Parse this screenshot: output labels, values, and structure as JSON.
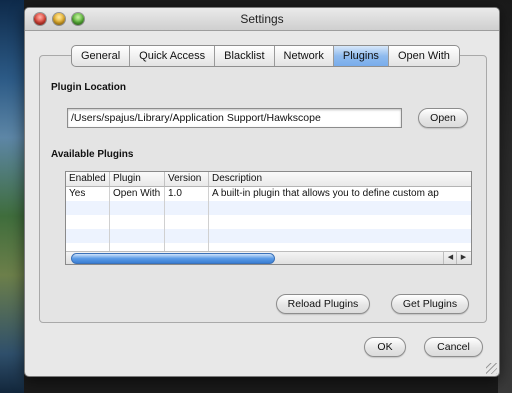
{
  "window": {
    "title": "Settings"
  },
  "tabs": [
    {
      "label": "General"
    },
    {
      "label": "Quick Access"
    },
    {
      "label": "Blacklist"
    },
    {
      "label": "Network"
    },
    {
      "label": "Plugins"
    },
    {
      "label": "Open With"
    }
  ],
  "plugin_location": {
    "label": "Plugin Location",
    "value": "/Users/spajus/Library/Application Support/Hawkscope",
    "open_button": "Open"
  },
  "available_plugins": {
    "label": "Available Plugins",
    "columns": [
      "Enabled",
      "Plugin",
      "Version",
      "Description"
    ],
    "rows": [
      [
        "Yes",
        "Open With",
        "1.0",
        "A built-in plugin that allows you to define custom ap"
      ]
    ],
    "reload_button": "Reload Plugins",
    "get_button": "Get Plugins"
  },
  "footer": {
    "ok_button": "OK",
    "cancel_button": "Cancel"
  }
}
